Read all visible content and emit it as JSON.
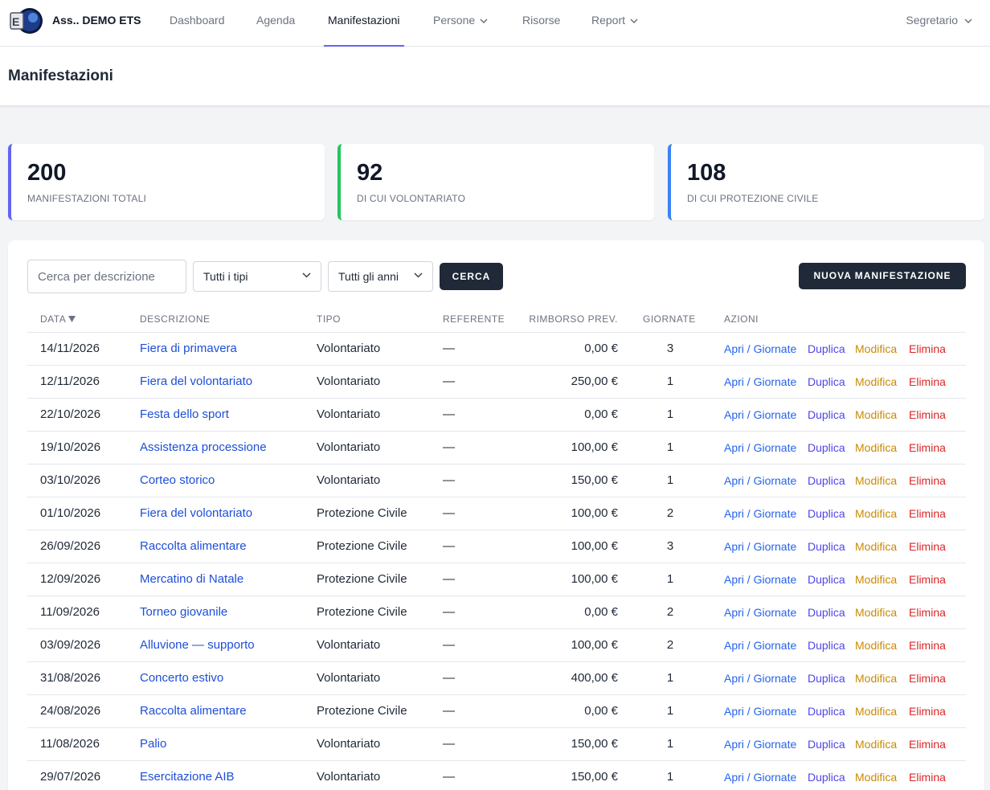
{
  "nav": {
    "brand": "Ass.. DEMO ETS",
    "items": [
      {
        "label": "Dashboard"
      },
      {
        "label": "Agenda"
      },
      {
        "label": "Manifestazioni"
      },
      {
        "label": "Persone"
      },
      {
        "label": "Risorse"
      },
      {
        "label": "Report"
      }
    ],
    "user": "Segretario"
  },
  "header": {
    "title": "Manifestazioni"
  },
  "stats": [
    {
      "value": "200",
      "label": "MANIFESTAZIONI TOTALI",
      "color": "#6366f1"
    },
    {
      "value": "92",
      "label": "DI CUI VOLONTARIATO",
      "color": "#22c55e"
    },
    {
      "value": "108",
      "label": "DI CUI PROTEZIONE CIVILE",
      "color": "#3b82f6"
    }
  ],
  "filters": {
    "search_placeholder": "Cerca per descrizione",
    "type_selected": "Tutti i tipi",
    "year_selected": "Tutti gli anni",
    "search_button": "CERCA",
    "new_button": "NUOVA MANIFESTAZIONE"
  },
  "table": {
    "headers": {
      "data": "DATA",
      "descrizione": "DESCRIZIONE",
      "tipo": "TIPO",
      "referente": "REFERENTE",
      "rimborso": "RIMBORSO PREV.",
      "giornate": "GIORNATE",
      "azioni": "AZIONI"
    },
    "actions": {
      "open": "Apri / Giornate",
      "duplicate": "Duplica",
      "edit": "Modifica",
      "delete": "Elimina"
    },
    "rows": [
      {
        "data": "14/11/2026",
        "descrizione": "Fiera di primavera",
        "tipo": "Volontariato",
        "referente": "—",
        "rimborso": "0,00 €",
        "giornate": "3"
      },
      {
        "data": "12/11/2026",
        "descrizione": "Fiera del volontariato",
        "tipo": "Volontariato",
        "referente": "—",
        "rimborso": "250,00 €",
        "giornate": "1"
      },
      {
        "data": "22/10/2026",
        "descrizione": "Festa dello sport",
        "tipo": "Volontariato",
        "referente": "—",
        "rimborso": "0,00 €",
        "giornate": "1"
      },
      {
        "data": "19/10/2026",
        "descrizione": "Assistenza processione",
        "tipo": "Volontariato",
        "referente": "—",
        "rimborso": "100,00 €",
        "giornate": "1"
      },
      {
        "data": "03/10/2026",
        "descrizione": "Corteo storico",
        "tipo": "Volontariato",
        "referente": "—",
        "rimborso": "150,00 €",
        "giornate": "1"
      },
      {
        "data": "01/10/2026",
        "descrizione": "Fiera del volontariato",
        "tipo": "Protezione Civile",
        "referente": "—",
        "rimborso": "100,00 €",
        "giornate": "2"
      },
      {
        "data": "26/09/2026",
        "descrizione": "Raccolta alimentare",
        "tipo": "Protezione Civile",
        "referente": "—",
        "rimborso": "100,00 €",
        "giornate": "3"
      },
      {
        "data": "12/09/2026",
        "descrizione": "Mercatino di Natale",
        "tipo": "Protezione Civile",
        "referente": "—",
        "rimborso": "100,00 €",
        "giornate": "1"
      },
      {
        "data": "11/09/2026",
        "descrizione": "Torneo giovanile",
        "tipo": "Protezione Civile",
        "referente": "—",
        "rimborso": "0,00 €",
        "giornate": "2"
      },
      {
        "data": "03/09/2026",
        "descrizione": "Alluvione — supporto",
        "tipo": "Volontariato",
        "referente": "—",
        "rimborso": "100,00 €",
        "giornate": "2"
      },
      {
        "data": "31/08/2026",
        "descrizione": "Concerto estivo",
        "tipo": "Volontariato",
        "referente": "—",
        "rimborso": "400,00 €",
        "giornate": "1"
      },
      {
        "data": "24/08/2026",
        "descrizione": "Raccolta alimentare",
        "tipo": "Protezione Civile",
        "referente": "—",
        "rimborso": "0,00 €",
        "giornate": "1"
      },
      {
        "data": "11/08/2026",
        "descrizione": "Palio",
        "tipo": "Volontariato",
        "referente": "—",
        "rimborso": "150,00 €",
        "giornate": "1"
      },
      {
        "data": "29/07/2026",
        "descrizione": "Esercitazione AIB",
        "tipo": "Volontariato",
        "referente": "—",
        "rimborso": "150,00 €",
        "giornate": "1"
      }
    ]
  }
}
